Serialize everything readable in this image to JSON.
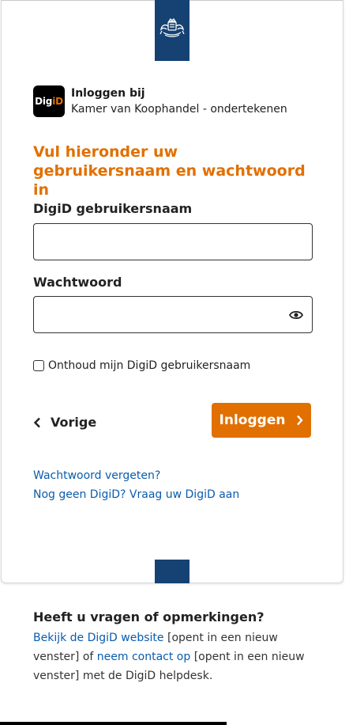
{
  "brand": {
    "logo_text_white": "Dig",
    "logo_text_orange": "iD",
    "line1": "Inloggen bij",
    "line2": "Kamer van Koophandel - ondertekenen"
  },
  "heading": "Vul hieronder uw gebruikersnaam en wachtwoord in",
  "username": {
    "label": "DigiD gebruikersnaam",
    "value": ""
  },
  "password": {
    "label": "Wachtwoord",
    "value": ""
  },
  "remember": {
    "label": "Onthoud mijn DigiD gebruikersnaam",
    "checked": false
  },
  "actions": {
    "back_label": "Vorige",
    "login_label": "Inloggen"
  },
  "links": {
    "forgot": "Wachtwoord vergeten?",
    "no_digid": "Nog geen DigiD? Vraag uw DigiD aan"
  },
  "help": {
    "title": "Heeft u vragen of opmerkingen?",
    "link1": "Bekijk de DigiD website",
    "text1": " [opent in een nieuw venster] of ",
    "link2": "neem contact op",
    "text2": " [opent in een nieuw venster] met de DigiD helpdesk."
  },
  "colors": {
    "accent": "#e17000",
    "gov_blue": "#154273",
    "link": "#0a5cad"
  },
  "icons": {
    "password_toggle": "eye-icon",
    "back": "chevron-left-icon",
    "login": "chevron-right-icon"
  }
}
